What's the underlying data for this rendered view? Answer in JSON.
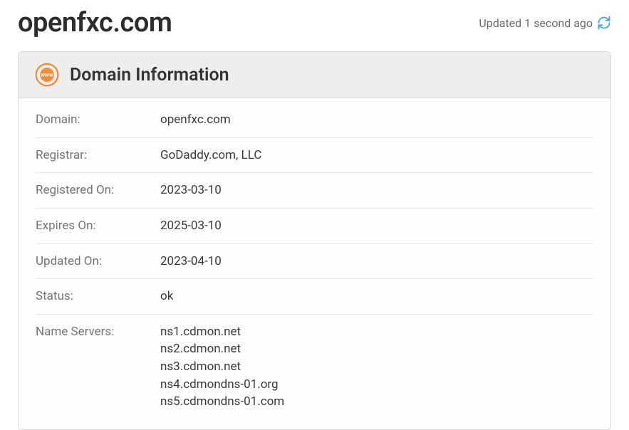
{
  "header": {
    "domain_title": "openfxc.com",
    "updated_text": "Updated 1 second ago"
  },
  "panel": {
    "title": "Domain Information",
    "rows": {
      "domain": {
        "label": "Domain:",
        "value": "openfxc.com"
      },
      "registrar": {
        "label": "Registrar:",
        "value": "GoDaddy.com, LLC"
      },
      "registered_on": {
        "label": "Registered On:",
        "value": "2023-03-10"
      },
      "expires_on": {
        "label": "Expires On:",
        "value": "2025-03-10"
      },
      "updated_on": {
        "label": "Updated On:",
        "value": "2023-04-10"
      },
      "status": {
        "label": "Status:",
        "value": "ok"
      },
      "name_servers": {
        "label": "Name Servers:",
        "values": [
          "ns1.cdmon.net",
          "ns2.cdmon.net",
          "ns3.cdmon.net",
          "ns4.cdmondns-01.org",
          "ns5.cdmondns-01.com"
        ]
      }
    }
  }
}
